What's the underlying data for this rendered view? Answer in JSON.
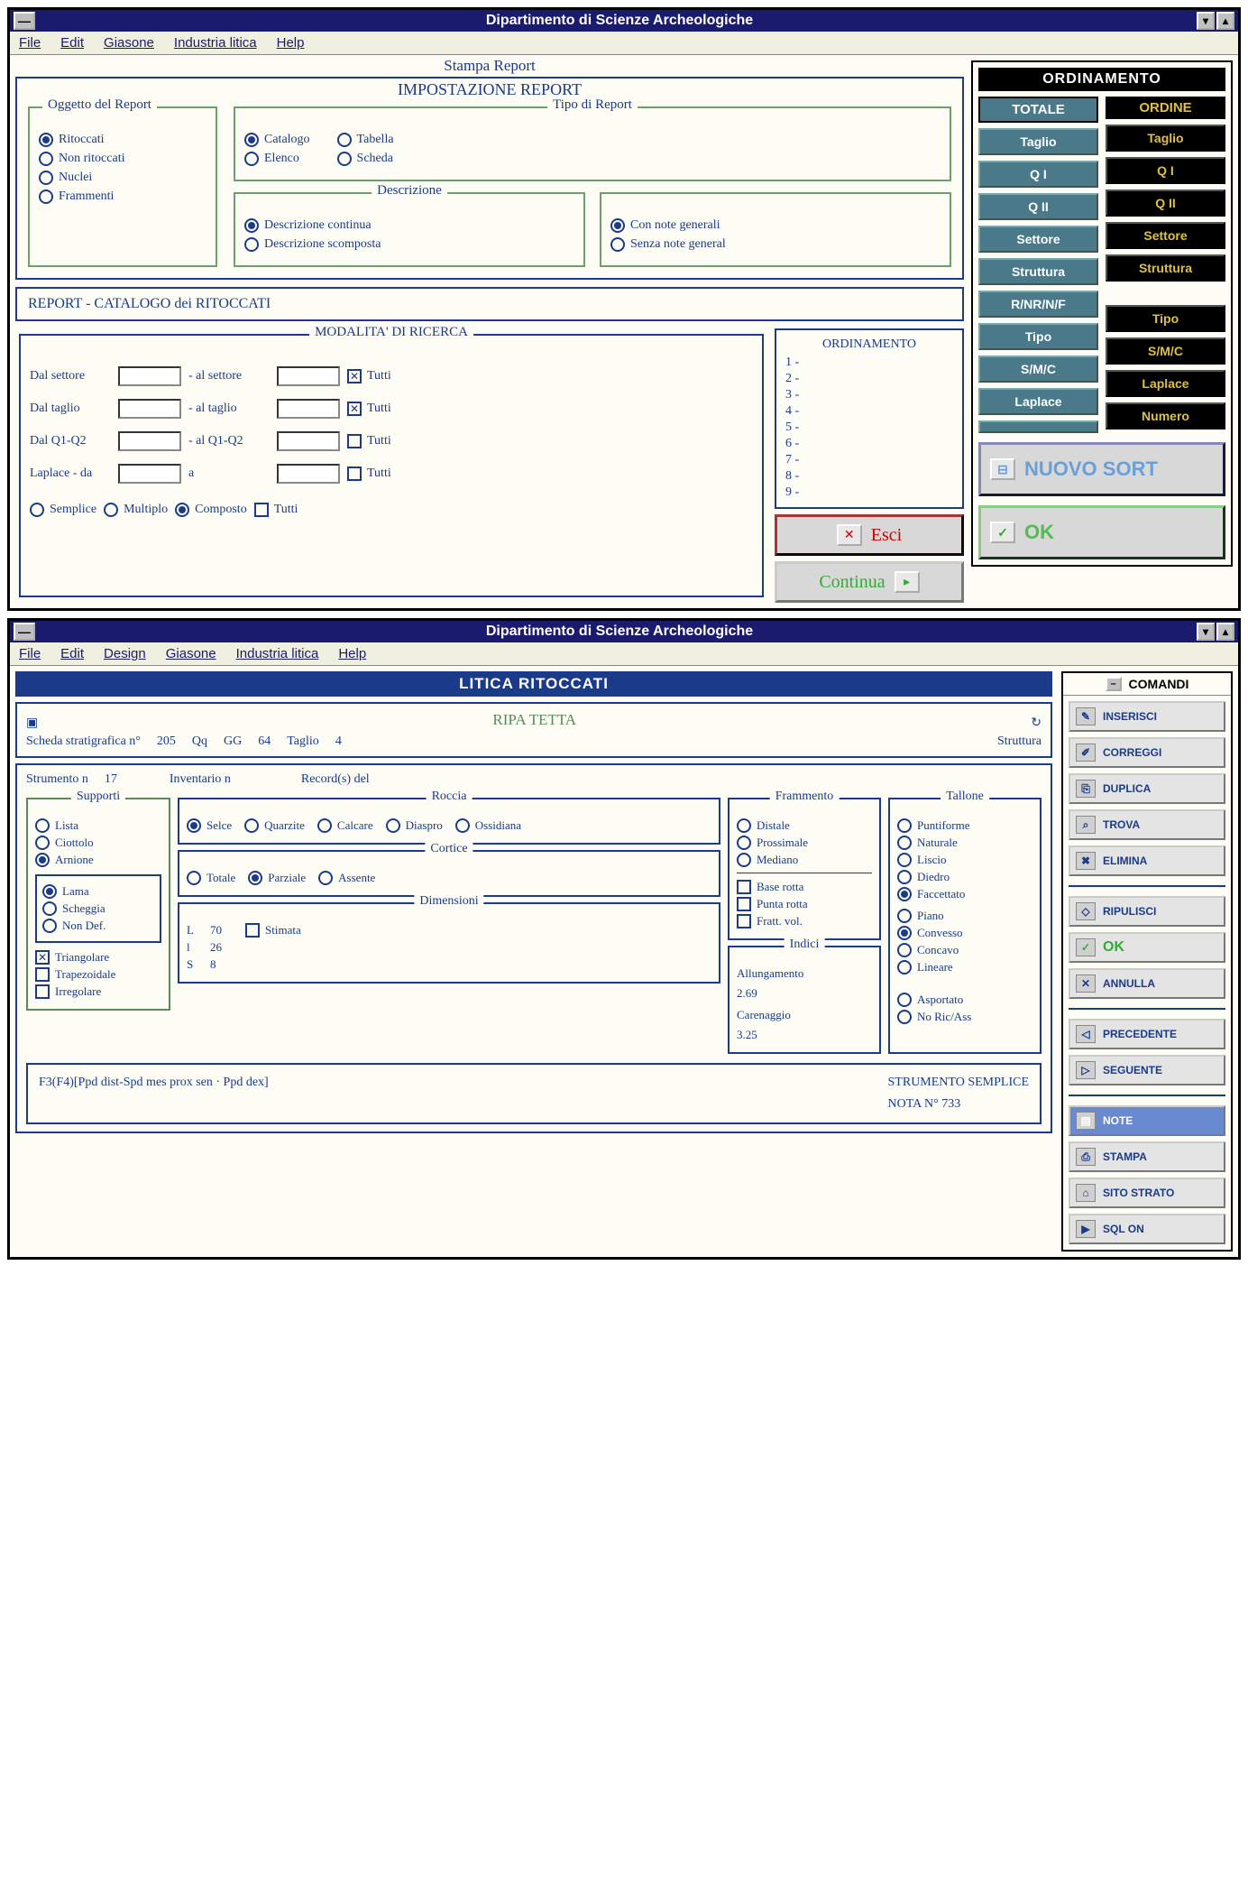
{
  "win1": {
    "title": "Dipartimento di Scienze Archeologiche",
    "menu": [
      "File",
      "Edit",
      "Giasone",
      "Industria litica",
      "Help"
    ],
    "stampa": "Stampa Report",
    "impost": {
      "title": "IMPOSTAZIONE REPORT",
      "oggetto": {
        "title": "Oggetto del Report",
        "opts": [
          "Ritoccati",
          "Non ritoccati",
          "Nuclei",
          "Frammenti"
        ],
        "sel": 0
      },
      "tipo": {
        "title": "Tipo di Report",
        "opts": [
          "Catalogo",
          "Tabella",
          "Elenco",
          "Scheda"
        ],
        "sel": 0
      },
      "descr": {
        "title": "Descrizione",
        "opts": [
          "Descrizione continua",
          "Descrizione scomposta"
        ],
        "sel": 0
      },
      "note": {
        "opts": [
          "Con note generali",
          "Senza note general"
        ],
        "sel": 0
      }
    },
    "report_bar": "REPORT - CATALOGO dei RITOCCATI",
    "ricerca": {
      "title": "MODALITA' DI RICERCA",
      "rows": [
        {
          "l1": "Dal settore",
          "l2": "- al settore",
          "tutti": true
        },
        {
          "l1": "Dal taglio",
          "l2": "- al  taglio",
          "tutti": true
        },
        {
          "l1": "Dal Q1-Q2",
          "l2": "- al  Q1-Q2",
          "tutti": false
        },
        {
          "l1": "Laplace - da",
          "l2": "a",
          "tutti": false
        }
      ],
      "tutti_label": "Tutti",
      "mode": {
        "opts": [
          "Semplice",
          "Multiplo",
          "Composto"
        ],
        "sel": 2,
        "tutti": false
      }
    },
    "ordlist": {
      "title": "ORDINAMENTO",
      "items": [
        "1 -",
        "2 -",
        "3 -",
        "4 -",
        "5 -",
        "6 -",
        "7 -",
        "8 -",
        "9 -"
      ]
    },
    "esci": "Esci",
    "continua": "Continua",
    "ordpanel": {
      "title": "ORDINAMENTO",
      "totale": {
        "head": "TOTALE",
        "items": [
          "Taglio",
          "Q  I",
          "Q  II",
          "Settore",
          "Struttura",
          "R/NR/N/F",
          "Tipo",
          "S/M/C",
          "Laplace",
          ""
        ]
      },
      "ordine": {
        "head": "ORDINE",
        "items": [
          "Taglio",
          "Q  I",
          "Q  II",
          "Settore",
          "Struttura",
          "",
          "Tipo",
          "S/M/C",
          "Laplace",
          "Numero"
        ]
      },
      "nuovo": "NUOVO SORT",
      "ok": "OK"
    }
  },
  "win2": {
    "title": "Dipartimento di Scienze Archeologiche",
    "menu": [
      "File",
      "Edit",
      "Design",
      "Giasone",
      "Industria litica",
      "Help"
    ],
    "header": "LITICA RITOCCATI",
    "info": {
      "sito": "RIPA TETTA",
      "scheda_lbl": "Scheda stratigrafica n°",
      "scheda_n": "205",
      "qq": "Qq",
      "gg": "GG",
      "num": "64",
      "taglio_lbl": "Taglio",
      "taglio_n": "4",
      "strutt": "Struttura"
    },
    "strum": {
      "lbl": "Strumento  n",
      "n": "17",
      "inv": "Inventario n",
      "rec": "Record(s) del"
    },
    "supporti": {
      "title": "Supporti",
      "g1": {
        "opts": [
          "Lista",
          "Ciottolo",
          "Arnione"
        ],
        "sel": 2
      },
      "g2": {
        "opts": [
          "Lama",
          "Scheggia",
          "Non Def."
        ],
        "sel": 0
      },
      "g3": {
        "opts": [
          "Triangolare",
          "Trapezoidale",
          "Irregolare"
        ],
        "sel": [
          true,
          false,
          false
        ]
      }
    },
    "roccia": {
      "title": "Roccia",
      "opts": [
        "Selce",
        "Quarzite",
        "Calcare",
        "Diaspro",
        "Ossidiana"
      ],
      "sel": 0
    },
    "cortice": {
      "title": "Cortice",
      "opts": [
        "Totale",
        "Parziale",
        "Assente"
      ],
      "sel": 1
    },
    "dimens": {
      "title": "Dimensioni",
      "L": "70",
      "l": "26",
      "S": "8",
      "stim": "Stimata"
    },
    "framm": {
      "title": "Frammento",
      "opts": [
        "Distale",
        "Prossimale",
        "Mediano"
      ],
      "chk": [
        "Base rotta",
        "Punta rotta",
        "Fratt. vol."
      ]
    },
    "indici": {
      "title": "Indici",
      "all_lbl": "Allungamento",
      "all": "2.69",
      "car_lbl": "Carenaggio",
      "car": "3.25"
    },
    "tallone": {
      "title": "Tallone",
      "g1": {
        "opts": [
          "Puntiforme",
          "Naturale",
          "Liscio",
          "Diedro",
          "Faccettato"
        ],
        "sel": 4
      },
      "g2": {
        "opts": [
          "Piano",
          "Convesso",
          "Concavo",
          "Lineare"
        ],
        "sel": 1
      },
      "g3": {
        "opts": [
          "Asportato",
          "No Ric/Ass"
        ]
      }
    },
    "formula": "F3(F4)[Ppd dist-Spd mes prox sen · Ppd dex]",
    "strum_sem": "STRUMENTO SEMPLICE",
    "nota": "NOTA N° 733",
    "cmd": {
      "title": "COMANDI",
      "items": [
        "INSERISCI",
        "CORREGGI",
        "DUPLICA",
        "TROVA",
        "ELIMINA"
      ],
      "items2": [
        "RIPULISCI",
        "OK",
        "ANNULLA"
      ],
      "items3": [
        "PRECEDENTE",
        "SEGUENTE"
      ],
      "items4": [
        "NOTE",
        "STAMPA",
        "SITO STRATO",
        "SQL  ON"
      ]
    }
  }
}
